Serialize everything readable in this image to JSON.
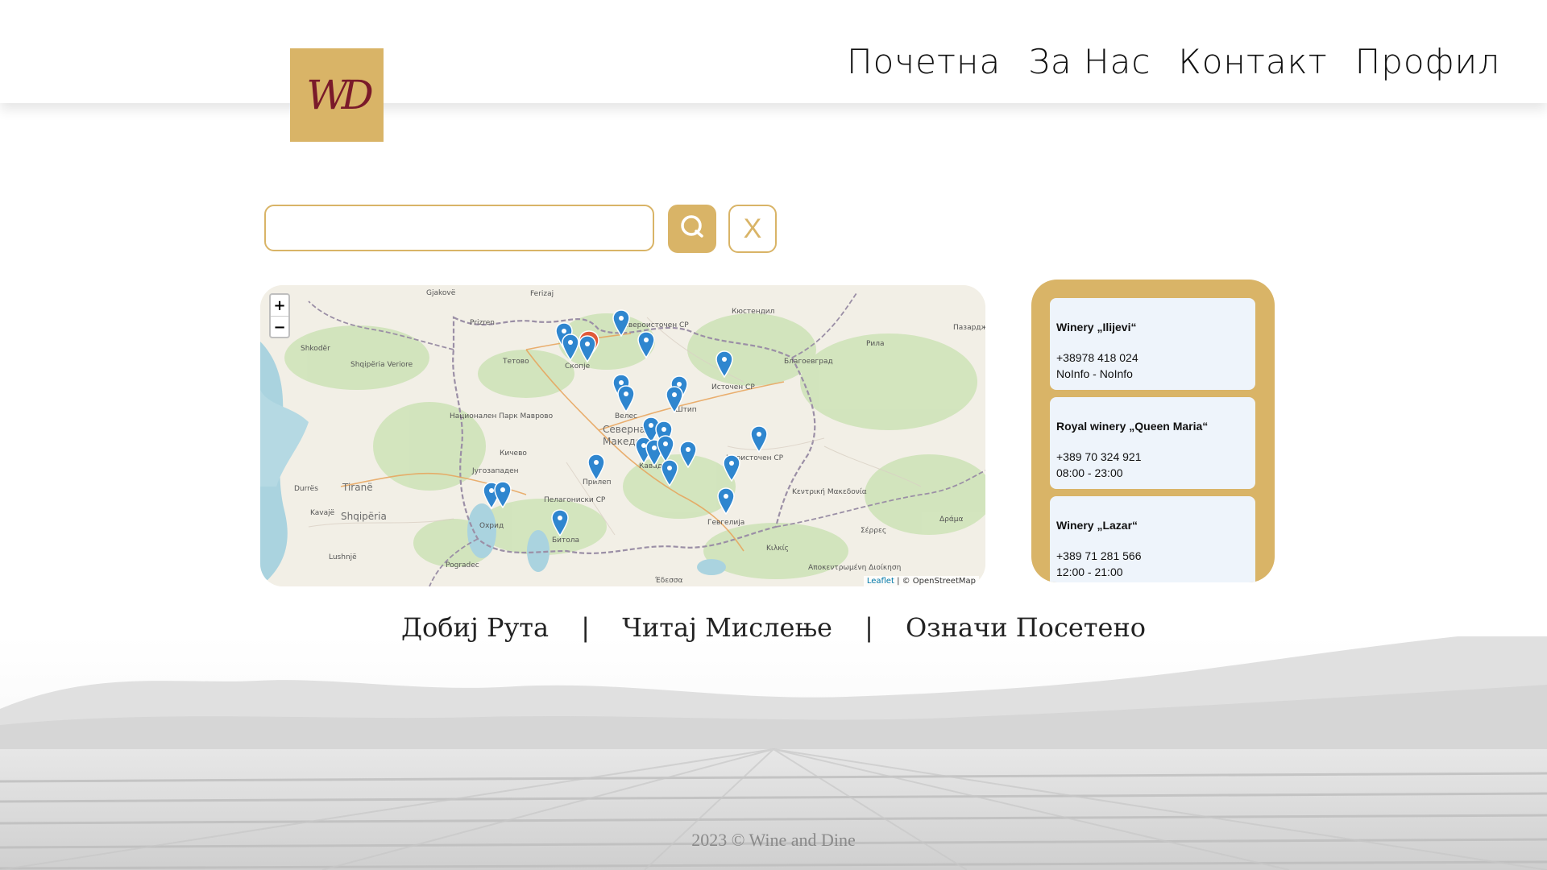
{
  "brand": {
    "logo_text": "WD",
    "accent_color": "#d9b467",
    "logo_ink": "#7a1a2a"
  },
  "nav": [
    {
      "label": "Почетна"
    },
    {
      "label": "За Нас"
    },
    {
      "label": "Контакт"
    },
    {
      "label": "Профил"
    }
  ],
  "search": {
    "placeholder": "",
    "value": "",
    "search_icon": "search-icon",
    "clear_label": "X"
  },
  "map": {
    "zoom_in": "+",
    "zoom_out": "−",
    "attribution_leaflet": "Leaflet",
    "attribution_osm": "| © OpenStreetMap",
    "labels": {
      "gjakove": "Gjakovë",
      "ferizaj": "Ferizaj",
      "prizren": "Prizren",
      "shkoder": "Shkodër",
      "shqiperia_veriore": "Shqipëria Veriore",
      "tetovo": "Тетово",
      "skopje": "Скопје",
      "kyustendil": "Кюстендил",
      "rila": "Рила",
      "blagoevgrad": "Благоевград",
      "pazardzhik": "Пазардж",
      "severoistochen": "Североисточен СР",
      "istochen": "Источен СР",
      "veles": "Велес",
      "shtip": "Штип",
      "severna": "Северна",
      "makedonija": "Македон",
      "nac_park": "Национален Парк Маврово",
      "kichevo": "Кичево",
      "jugozapaden": "Југозападен",
      "prilep": "Прилеп",
      "kavadarci": "Кавад",
      "jugoistochen": "Југоисточен СР",
      "durres": "Durrës",
      "tirane": "Tiranë",
      "shqiperia": "Shqipëria",
      "kavaje": "Kavajë",
      "ohrid": "Охрид",
      "pelagoniski": "Пелагониски СР",
      "bitola": "Битола",
      "gevgelija": "Гевгелија",
      "kentriki": "Κεντρική Μακεδονία",
      "serres": "Σέρρες",
      "drama": "Δράμα",
      "kilkis": "Κιλκίς",
      "lushnje": "Lushnjë",
      "pogradec": "Pogradec",
      "edessa": "Έδεσσα",
      "anatoliki": "Αποκεντρωμένη Διοίκηση"
    }
  },
  "wineries": [
    {
      "name": "Winery „Ilijevi“",
      "phone": "+38978 418 024",
      "hours": "NoInfo - NoInfo"
    },
    {
      "name": "Royal winery „Queen Maria“",
      "phone": "+389 70 324 921",
      "hours": "08:00 - 23:00"
    },
    {
      "name": "Winery „Lazar“",
      "phone": "+389 71 281 566",
      "hours": "12:00 - 21:00"
    }
  ],
  "actions": {
    "get_route": "Добиј Рута",
    "separator": "|",
    "read_reviews": "Читај Мислење",
    "mark_visited": "Означи Посетено"
  },
  "footer": {
    "text": "2023 © Wine and Dine"
  }
}
